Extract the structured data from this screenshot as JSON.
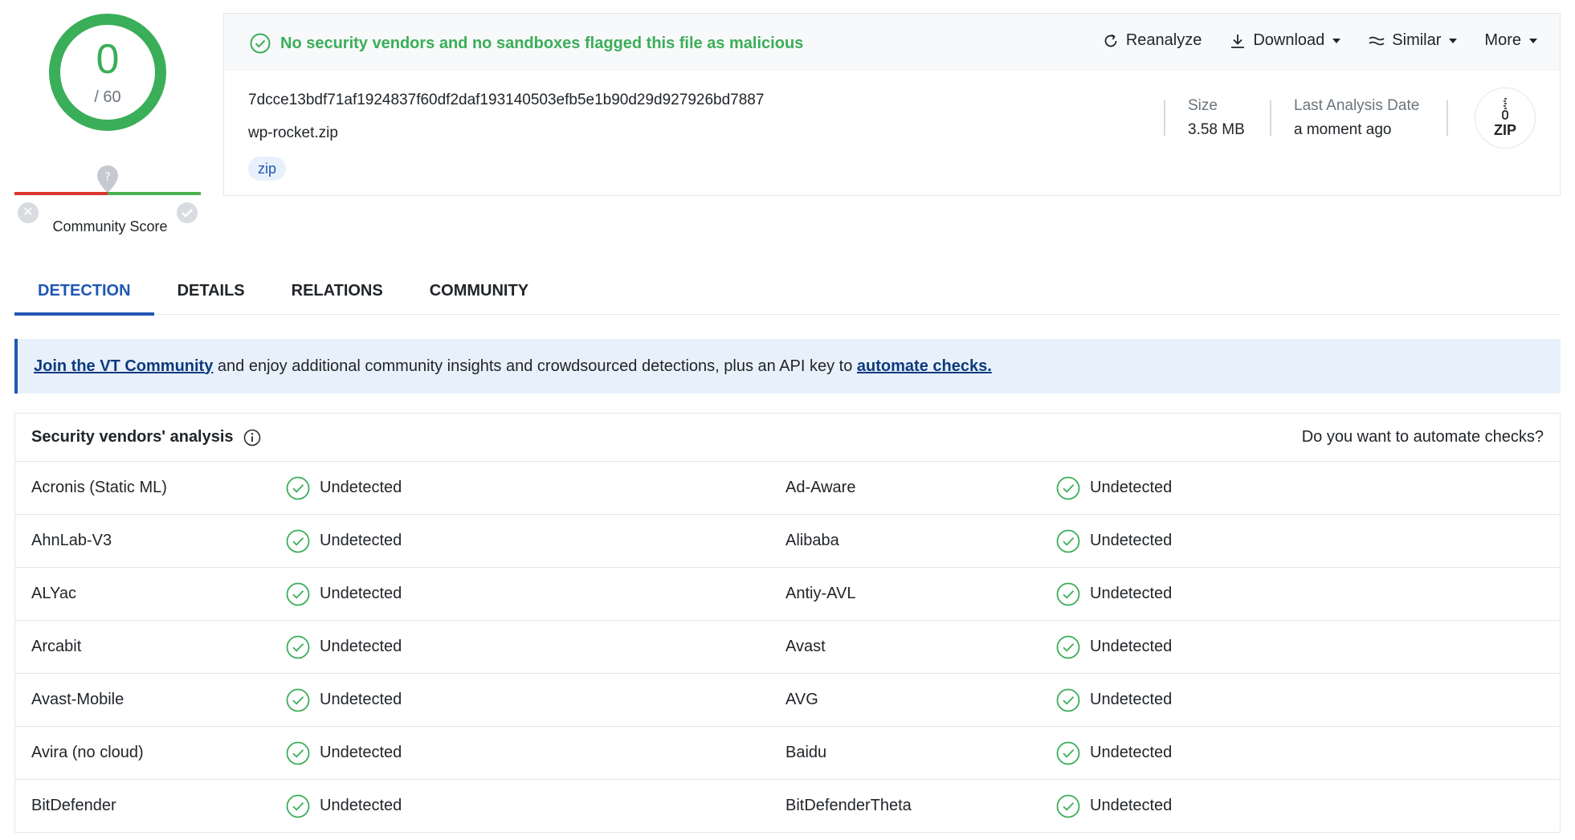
{
  "score": {
    "value": "0",
    "total": "/ 60",
    "ring_color": "#3aae58"
  },
  "community": {
    "label": "Community Score",
    "unknown_icon": "question-icon"
  },
  "verdict": {
    "text": "No security vendors and no sandboxes flagged this file as malicious",
    "color": "#3aae58"
  },
  "actions": {
    "reanalyze": "Reanalyze",
    "download": "Download",
    "similar": "Similar",
    "more": "More"
  },
  "file": {
    "hash": "7dcce13bdf71af1924837f60df2daf193140503efb5e1b90d29d927926bd7887",
    "name": "wp-rocket.zip",
    "tag": "zip",
    "size_label": "Size",
    "size_value": "3.58 MB",
    "date_label": "Last Analysis Date",
    "date_value": "a moment ago",
    "type_badge": "ZIP"
  },
  "tabs": [
    {
      "label": "DETECTION",
      "active": true
    },
    {
      "label": "DETAILS",
      "active": false
    },
    {
      "label": "RELATIONS",
      "active": false
    },
    {
      "label": "COMMUNITY",
      "active": false
    }
  ],
  "banner": {
    "link1": "Join the VT Community",
    "text": " and enjoy additional community insights and crowdsourced detections, plus an API key to ",
    "link2": "automate checks."
  },
  "vendors": {
    "title": "Security vendors' analysis",
    "automate": "Do you want to automate checks?",
    "rows": [
      {
        "left_name": "Acronis (Static ML)",
        "left_result": "Undetected",
        "right_name": "Ad-Aware",
        "right_result": "Undetected"
      },
      {
        "left_name": "AhnLab-V3",
        "left_result": "Undetected",
        "right_name": "Alibaba",
        "right_result": "Undetected"
      },
      {
        "left_name": "ALYac",
        "left_result": "Undetected",
        "right_name": "Antiy-AVL",
        "right_result": "Undetected"
      },
      {
        "left_name": "Arcabit",
        "left_result": "Undetected",
        "right_name": "Avast",
        "right_result": "Undetected"
      },
      {
        "left_name": "Avast-Mobile",
        "left_result": "Undetected",
        "right_name": "AVG",
        "right_result": "Undetected"
      },
      {
        "left_name": "Avira (no cloud)",
        "left_result": "Undetected",
        "right_name": "Baidu",
        "right_result": "Undetected"
      },
      {
        "left_name": "BitDefender",
        "left_result": "Undetected",
        "right_name": "BitDefenderTheta",
        "right_result": "Undetected"
      }
    ]
  },
  "colors": {
    "accent": "#1f57b5",
    "ok": "#3aae58",
    "bad": "#dd3333"
  }
}
